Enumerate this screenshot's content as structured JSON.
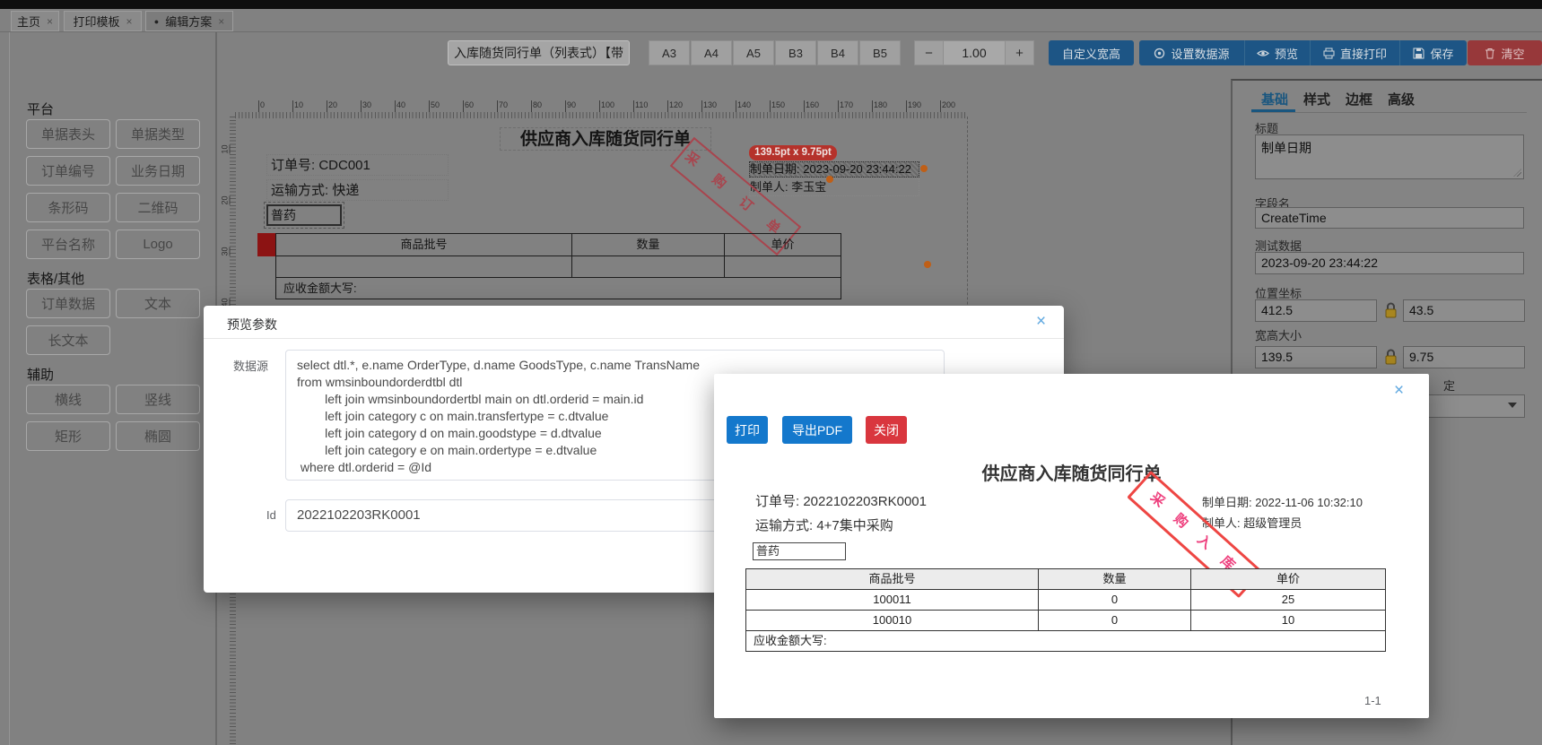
{
  "tabs": [
    {
      "label": "主页",
      "close": "×",
      "active": false
    },
    {
      "label": "打印模板",
      "close": "×",
      "active": false
    },
    {
      "label": "编辑方案",
      "close": "×",
      "active": true,
      "dot": "●"
    }
  ],
  "toolbar": {
    "template_name": "入库随货同行单（列表式）【带",
    "paper_sizes": [
      "A3",
      "A4",
      "A5",
      "B3",
      "B4",
      "B5"
    ],
    "zoom": {
      "minus": "−",
      "value": "1.00",
      "plus": "+"
    },
    "custom_size": "自定义宽高",
    "set_datasource": "设置数据源",
    "preview": "预览",
    "direct_print": "直接打印",
    "save": "保存",
    "clear": "清空"
  },
  "palette": {
    "sections": [
      {
        "title": "平台",
        "items": [
          "单据表头",
          "单据类型",
          "订单编号",
          "业务日期",
          "条形码",
          "二维码",
          "平台名称",
          "Logo"
        ]
      },
      {
        "title": "表格/其他",
        "items": [
          "订单数据",
          "文本",
          "长文本"
        ]
      },
      {
        "title": "辅助",
        "items": [
          "横线",
          "竖线",
          "矩形",
          "椭圆"
        ]
      }
    ]
  },
  "canvas": {
    "hruler": [
      "0",
      "10",
      "20",
      "30",
      "40",
      "50",
      "60",
      "70",
      "80",
      "90",
      "100",
      "110",
      "120",
      "130",
      "140",
      "150",
      "160",
      "170",
      "180",
      "190",
      "200"
    ],
    "vruler": [
      "10",
      "20",
      "30",
      "40"
    ],
    "doc": {
      "title": "供应商入库随货同行单",
      "order_no": "订单号: CDC001",
      "trans": "运输方式: 快递",
      "drug": "普药",
      "size_tooltip": "139.5pt x 9.75pt",
      "make_date": "制单日期: 2023-09-20 23:44:22",
      "maker": "制单人: 李玉宝",
      "stamp": "采 购 订 单",
      "table_headers": [
        "商品批号",
        "数量",
        "单价"
      ],
      "table_footer": "应收金额大写:"
    }
  },
  "param_modal": {
    "title": "预览参数",
    "close": "×",
    "datasource_label": "数据源",
    "sql_lines": [
      "select dtl.*, e.name OrderType, d.name GoodsType, c.name TransName",
      "from wmsinboundorderdtbl dtl",
      "        left join wmsinboundordertbl main on dtl.orderid = main.id",
      "        left join category c on main.transfertype = c.dtvalue",
      "        left join category d on main.goodstype = d.dtvalue",
      "        left join category e on main.ordertype = e.dtvalue",
      " where dtl.orderid = @Id"
    ],
    "id_label": "Id",
    "id_value": "2022102203RK0001"
  },
  "preview_modal": {
    "close": "×",
    "buttons": {
      "print": "打印",
      "export_pdf": "导出PDF",
      "close": "关闭"
    },
    "doc": {
      "title": "供应商入库随货同行单",
      "order_no": "订单号: 2022102203RK0001",
      "make_date": "制单日期: 2022-11-06 10:32:10",
      "trans": "运输方式: 4+7集中采购",
      "maker": "制单人: 超级管理员",
      "drug": "普药",
      "stamp": "采 购 入 库",
      "table": {
        "headers": [
          "商品批号",
          "数量",
          "单价"
        ],
        "rows": [
          [
            "100011",
            "0",
            "25"
          ],
          [
            "100010",
            "0",
            "10"
          ]
        ],
        "footer": "应收金额大写:"
      },
      "page": "1-1"
    }
  },
  "inspector": {
    "tabs": [
      "基础",
      "样式",
      "边框",
      "高级"
    ],
    "active_tab": "基础",
    "title_label": "标题",
    "title_value": "制单日期",
    "field_label": "字段名",
    "field_value": "CreateTime",
    "test_label": "测试数据",
    "test_value": "2023-09-20 23:44:22",
    "pos_label": "位置坐标",
    "pos_x": "412.5",
    "pos_y": "43.5",
    "size_label": "宽高大小",
    "size_w": "139.5",
    "size_h": "9.75",
    "partial_label": "定"
  },
  "colors": {
    "toolbar_blue": "#1d5585",
    "toolbar_red": "#97383a",
    "modal_blue": "#1478cc",
    "modal_red": "#d9363e",
    "tooltip_red": "#b5322b",
    "canvas_stamp": "#a8454e",
    "preview_stamp_border": "#ee4643",
    "preview_stamp_text": "#ee3f7d",
    "handle_orange": "#bf5f17",
    "lock_gold": "#a8861f",
    "tab_active_blue": "#19567f"
  }
}
